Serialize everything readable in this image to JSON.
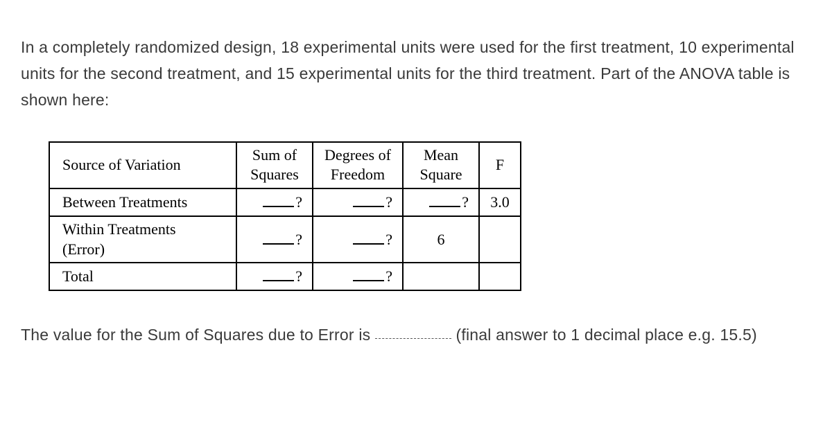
{
  "intro": "In a completely randomized design, 18 experimental units were used for the first treatment, 10 experimental units for the second treatment, and 15 experimental units for the third treatment. Part of the ANOVA table is shown here:",
  "table": {
    "headers": {
      "source": "Source of Variation",
      "ss_l1": "Sum of",
      "ss_l2": "Squares",
      "df_l1": "Degrees of",
      "df_l2": "Freedom",
      "ms_l1": "Mean",
      "ms_l2": "Square",
      "f": "F"
    },
    "rows": {
      "between": {
        "label": "Between Treatments",
        "ss": "?",
        "df": "?",
        "ms": "?",
        "f": "3.0"
      },
      "within": {
        "label_l1": "Within Treatments",
        "label_l2": "(Error)",
        "ss": "?",
        "df": "?",
        "ms": "6",
        "f": ""
      },
      "total": {
        "label": "Total",
        "ss": "?",
        "df": "?",
        "ms": "",
        "f": ""
      }
    }
  },
  "question_prefix": "The value for the Sum of Squares due to Error is ",
  "question_suffix": " (final answer to 1 decimal place e.g. 15.5)"
}
